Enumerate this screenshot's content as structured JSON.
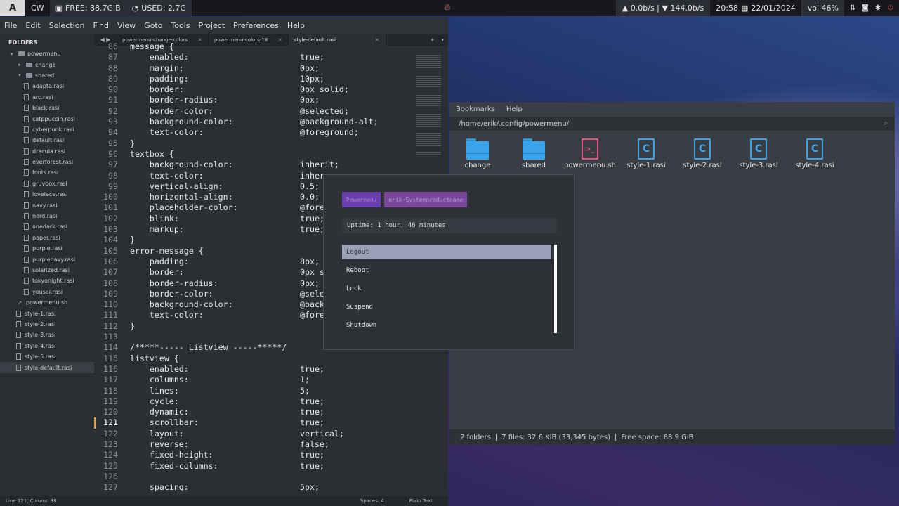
{
  "topbar": {
    "logo": "A",
    "workspace": "CW",
    "free": "FREE: 88.7GiB",
    "used": "USED: 2.7G",
    "network": "▲ 0.0b/s | ▼ 144.0b/s",
    "clock": "20:58",
    "date": "22/01/2024",
    "volume": "vol 46%"
  },
  "editor": {
    "menu": [
      "File",
      "Edit",
      "Selection",
      "Find",
      "View",
      "Goto",
      "Tools",
      "Project",
      "Preferences",
      "Help"
    ],
    "sidebar": {
      "header": "FOLDERS",
      "items": [
        {
          "label": "powermenu",
          "type": "folder-open",
          "indent": 1
        },
        {
          "label": "change",
          "type": "folder",
          "indent": 2
        },
        {
          "label": "shared",
          "type": "folder-open",
          "indent": 2
        },
        {
          "label": "adapta.rasi",
          "type": "file",
          "indent": 3
        },
        {
          "label": "arc.rasi",
          "type": "file",
          "indent": 3
        },
        {
          "label": "black.rasi",
          "type": "file",
          "indent": 3
        },
        {
          "label": "catppuccin.rasi",
          "type": "file",
          "indent": 3
        },
        {
          "label": "cyberpunk.rasi",
          "type": "file",
          "indent": 3
        },
        {
          "label": "default.rasi",
          "type": "file",
          "indent": 3
        },
        {
          "label": "dracula.rasi",
          "type": "file",
          "indent": 3
        },
        {
          "label": "everforest.rasi",
          "type": "file",
          "indent": 3
        },
        {
          "label": "fonts.rasi",
          "type": "file",
          "indent": 3
        },
        {
          "label": "gruvbox.rasi",
          "type": "file",
          "indent": 3
        },
        {
          "label": "lovelace.rasi",
          "type": "file",
          "indent": 3
        },
        {
          "label": "navy.rasi",
          "type": "file",
          "indent": 3
        },
        {
          "label": "nord.rasi",
          "type": "file",
          "indent": 3
        },
        {
          "label": "onedark.rasi",
          "type": "file",
          "indent": 3
        },
        {
          "label": "paper.rasi",
          "type": "file",
          "indent": 3
        },
        {
          "label": "purple.rasi",
          "type": "file",
          "indent": 3
        },
        {
          "label": "purplenavy.rasi",
          "type": "file",
          "indent": 3
        },
        {
          "label": "solarized.rasi",
          "type": "file",
          "indent": 3
        },
        {
          "label": "tokyonight.rasi",
          "type": "file",
          "indent": 3
        },
        {
          "label": "yousai.rasi",
          "type": "file",
          "indent": 3
        },
        {
          "label": "powermenu.sh",
          "type": "script",
          "indent": 2
        },
        {
          "label": "style-1.rasi",
          "type": "file",
          "indent": 2
        },
        {
          "label": "style-2.rasi",
          "type": "file",
          "indent": 2
        },
        {
          "label": "style-3.rasi",
          "type": "file",
          "indent": 2
        },
        {
          "label": "style-4.rasi",
          "type": "file",
          "indent": 2
        },
        {
          "label": "style-5.rasi",
          "type": "file",
          "indent": 2
        },
        {
          "label": "style-default.rasi",
          "type": "file",
          "indent": 2,
          "selected": true
        }
      ]
    },
    "tabs": [
      {
        "label": "powermenu-change-colors",
        "active": false
      },
      {
        "label": "powermenu-colors-18",
        "active": false
      },
      {
        "label": "style-default.rasi",
        "active": true
      }
    ],
    "code_lines": [
      {
        "n": "86",
        "txt": "message {",
        "val": ""
      },
      {
        "n": "87",
        "txt": "    enabled:",
        "val": "true;"
      },
      {
        "n": "88",
        "txt": "    margin:",
        "val": "0px;"
      },
      {
        "n": "89",
        "txt": "    padding:",
        "val": "10px;"
      },
      {
        "n": "90",
        "txt": "    border:",
        "val": "0px solid;"
      },
      {
        "n": "91",
        "txt": "    border-radius:",
        "val": "0px;"
      },
      {
        "n": "92",
        "txt": "    border-color:",
        "val": "@selected;"
      },
      {
        "n": "93",
        "txt": "    background-color:",
        "val": "@background-alt;"
      },
      {
        "n": "94",
        "txt": "    text-color:",
        "val": "@foreground;"
      },
      {
        "n": "95",
        "txt": "}",
        "val": ""
      },
      {
        "n": "96",
        "txt": "textbox {",
        "val": ""
      },
      {
        "n": "97",
        "txt": "    background-color:",
        "val": "inherit;"
      },
      {
        "n": "98",
        "txt": "    text-color:",
        "val": "inher"
      },
      {
        "n": "99",
        "txt": "    vertical-align:",
        "val": "0.5;"
      },
      {
        "n": "100",
        "txt": "    horizontal-align:",
        "val": "0.0;"
      },
      {
        "n": "101",
        "txt": "    placeholder-color:",
        "val": "@fore"
      },
      {
        "n": "102",
        "txt": "    blink:",
        "val": "true;"
      },
      {
        "n": "103",
        "txt": "    markup:",
        "val": "true;"
      },
      {
        "n": "104",
        "txt": "}",
        "val": ""
      },
      {
        "n": "105",
        "txt": "error-message {",
        "val": ""
      },
      {
        "n": "106",
        "txt": "    padding:",
        "val": "8px;"
      },
      {
        "n": "107",
        "txt": "    border:",
        "val": "0px s"
      },
      {
        "n": "108",
        "txt": "    border-radius:",
        "val": "0px;"
      },
      {
        "n": "109",
        "txt": "    border-color:",
        "val": "@sele"
      },
      {
        "n": "110",
        "txt": "    background-color:",
        "val": "@back"
      },
      {
        "n": "111",
        "txt": "    text-color:",
        "val": "@fore"
      },
      {
        "n": "112",
        "txt": "}",
        "val": ""
      },
      {
        "n": "113",
        "txt": "",
        "val": ""
      },
      {
        "n": "114",
        "txt": "/*****----- Listview -----*****/",
        "val": ""
      },
      {
        "n": "115",
        "txt": "listview {",
        "val": ""
      },
      {
        "n": "116",
        "txt": "    enabled:",
        "val": "true;"
      },
      {
        "n": "117",
        "txt": "    columns:",
        "val": "1;"
      },
      {
        "n": "118",
        "txt": "    lines:",
        "val": "5;"
      },
      {
        "n": "119",
        "txt": "    cycle:",
        "val": "true;"
      },
      {
        "n": "120",
        "txt": "    dynamic:",
        "val": "true;"
      },
      {
        "n": "121",
        "txt": "    scrollbar:",
        "val": "true;",
        "current": true
      },
      {
        "n": "122",
        "txt": "    layout:",
        "val": "vertical;"
      },
      {
        "n": "123",
        "txt": "    reverse:",
        "val": "false;"
      },
      {
        "n": "124",
        "txt": "    fixed-height:",
        "val": "true;"
      },
      {
        "n": "125",
        "txt": "    fixed-columns:",
        "val": "true;"
      },
      {
        "n": "126",
        "txt": "",
        "val": ""
      },
      {
        "n": "127",
        "txt": "    spacing:",
        "val": "5px;"
      }
    ],
    "status": {
      "position": "Line 121, Column 38",
      "spaces": "Spaces: 4",
      "syntax": "Plain Text"
    }
  },
  "filemanager": {
    "menu": [
      "Bookmarks",
      "Help"
    ],
    "path": "/home/erik/.config/powermenu/",
    "items": [
      {
        "label": "change",
        "kind": "folder"
      },
      {
        "label": "shared",
        "kind": "folder"
      },
      {
        "label": "powermenu.sh",
        "kind": "script"
      },
      {
        "label": "style-1.rasi",
        "kind": "doc"
      },
      {
        "label": "style-2.rasi",
        "kind": "doc"
      },
      {
        "label": "style-3.rasi",
        "kind": "doc"
      },
      {
        "label": "style-4.rasi",
        "kind": "doc"
      }
    ],
    "status": {
      "folders": "2 folders",
      "files": "7 files: 32.6 KiB (33,345 bytes)",
      "free": "Free space: 88.9 GiB"
    }
  },
  "powermenu": {
    "pill_prompt": "Powermenu",
    "pill_host": "erik-Systemproductname",
    "uptime": "Uptime: 1 hour, 46 minutes",
    "options": [
      {
        "label": "Logout",
        "selected": true
      },
      {
        "label": "Reboot"
      },
      {
        "label": "Lock"
      },
      {
        "label": "Suspend"
      },
      {
        "label": "Shutdown"
      }
    ]
  }
}
